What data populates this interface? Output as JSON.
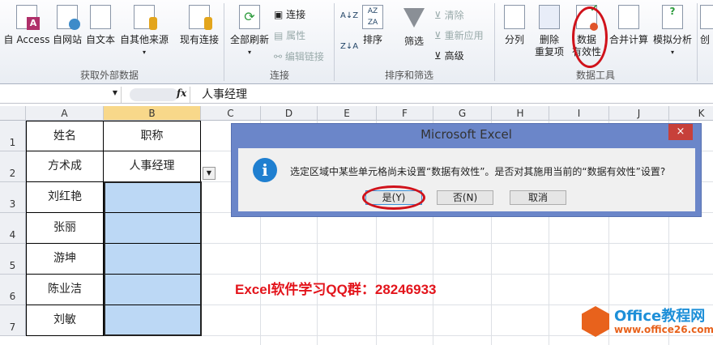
{
  "ribbon": {
    "get_external": {
      "access": "自 Access",
      "web": "自网站",
      "text": "自文本",
      "other": "自其他来源",
      "existing": "现有连接",
      "group": "获取外部数据"
    },
    "connections": {
      "refresh_all": "全部刷新",
      "connections": "连接",
      "properties": "属性",
      "edit_links": "编辑链接",
      "group": "连接"
    },
    "sort_filter": {
      "sort": "排序",
      "filter": "筛选",
      "clear": "清除",
      "reapply": "重新应用",
      "advanced": "高级",
      "group": "排序和筛选",
      "az": "A↓Z",
      "za": "Z↓A"
    },
    "data_tools": {
      "text_to_columns": "分列",
      "remove_dup_1": "删除",
      "remove_dup_2": "重复项",
      "validation_1": "数据",
      "validation_2": "有效性",
      "consolidate": "合并计算",
      "what_if": "模拟分析",
      "group": "数据工具"
    },
    "outline": {
      "create": "创"
    }
  },
  "formula_bar": {
    "fx": "fx",
    "value": "人事经理"
  },
  "columns": [
    "A",
    "B",
    "C",
    "D",
    "E",
    "F",
    "G",
    "H",
    "I",
    "J",
    "K"
  ],
  "rows": [
    "1",
    "2",
    "3",
    "4",
    "5",
    "6",
    "7"
  ],
  "cells": {
    "A": [
      "姓名",
      "方术成",
      "刘红艳",
      "张丽",
      "游坤",
      "陈业洁",
      "刘敏"
    ],
    "B": [
      "职称",
      "人事经理",
      "",
      "",
      "",
      "",
      ""
    ]
  },
  "dialog": {
    "title": "Microsoft Excel",
    "message": "选定区域中某些单元格尚未设置“数据有效性”。是否对其施用当前的“数据有效性”设置?",
    "yes": "是(Y)",
    "no": "否(N)",
    "cancel": "取消",
    "close": "×"
  },
  "annotation": "Excel软件学习QQ群：28246933",
  "watermark": {
    "brand": "Office教程网",
    "url": "www.office26.com"
  },
  "colors": {
    "accent_red": "#d0121b",
    "dialog_blue": "#6b86c9",
    "selection": "#bcd8f5",
    "logo_orange": "#e8621c"
  }
}
